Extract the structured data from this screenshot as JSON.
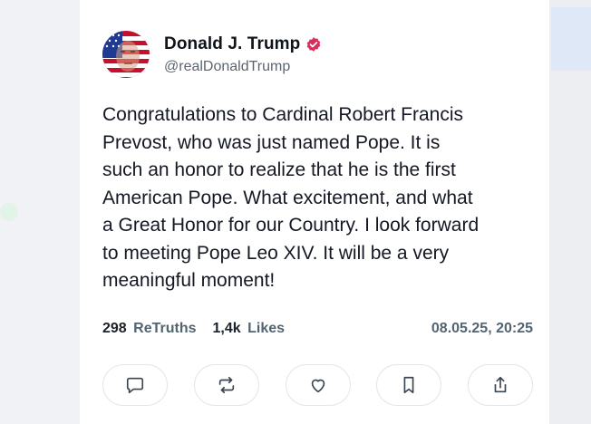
{
  "post": {
    "author_name": "Donald J. Trump",
    "author_handle": "@realDonaldTrump",
    "verified": true,
    "verified_color": "#d92d5b",
    "text": "Congratulations to Cardinal Robert Francis\nPrevost, who was just named Pope. It is\nsuch an honor to realize that he is the first\nAmerican Pope. What excitement, and what\na Great Honor for our Country. I look forward\nto meeting Pope Leo XIV. It will be a very\nmeaningful moment!",
    "stats": {
      "retruths_count": "298",
      "retruths_label": "ReTruths",
      "likes_count": "1,4k",
      "likes_label": "Likes"
    },
    "timestamp": "08.05.25, 20:25"
  },
  "actions": [
    {
      "name": "reply",
      "icon": "comment-icon"
    },
    {
      "name": "retruth",
      "icon": "repost-icon"
    },
    {
      "name": "like",
      "icon": "heart-icon"
    },
    {
      "name": "bookmark",
      "icon": "bookmark-icon"
    },
    {
      "name": "share",
      "icon": "share-icon"
    }
  ]
}
